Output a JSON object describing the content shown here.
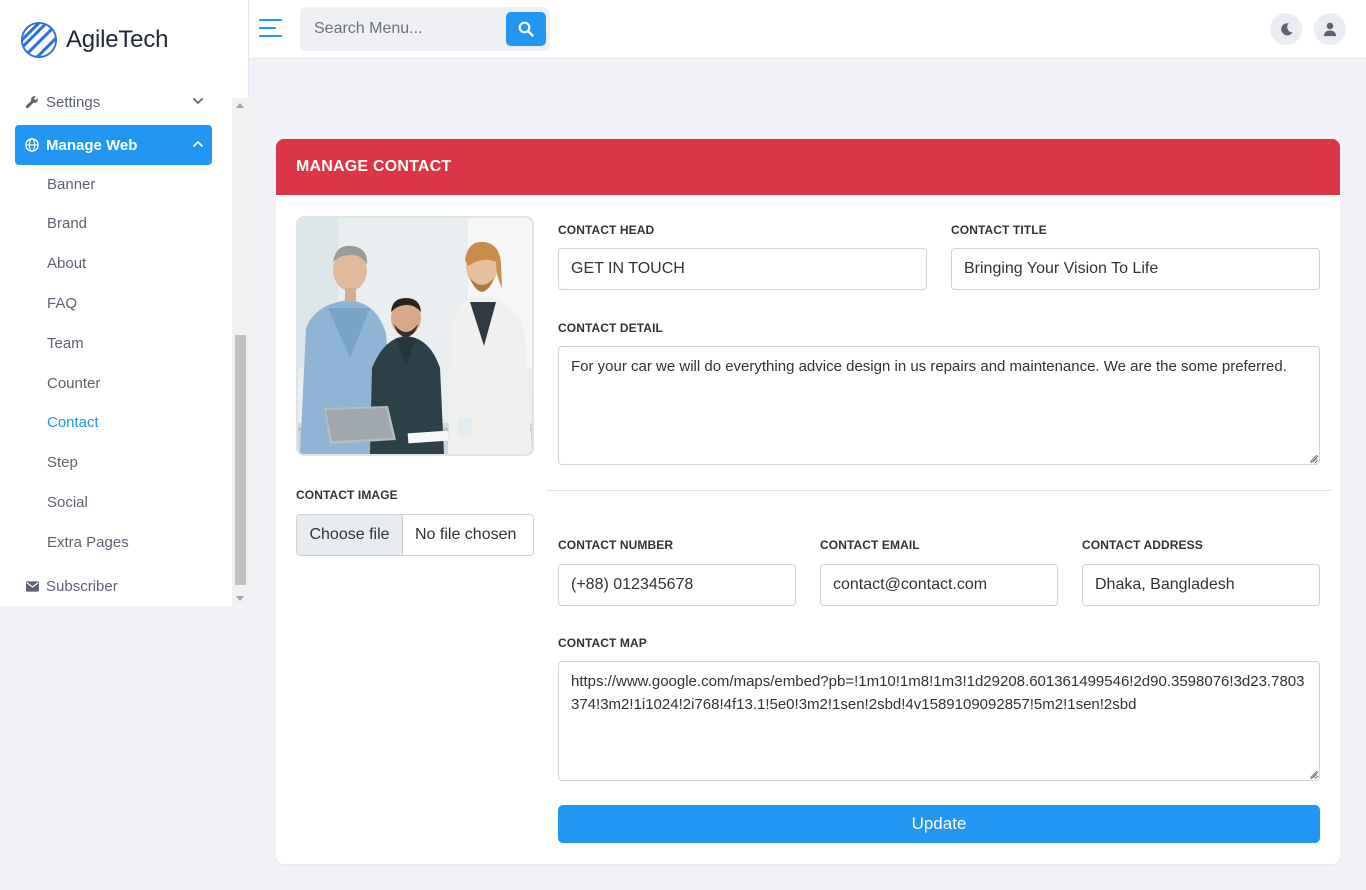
{
  "brand": {
    "name": "AgileTech"
  },
  "search": {
    "placeholder": "Search Menu..."
  },
  "sidebar": {
    "settings_label": "Settings",
    "manage_web_label": "Manage Web",
    "sub_items": [
      "Banner",
      "Brand",
      "About",
      "FAQ",
      "Team",
      "Counter",
      "Contact",
      "Step",
      "Social",
      "Extra Pages"
    ],
    "current_sub_item": "Contact",
    "subscriber_label": "Subscriber"
  },
  "card": {
    "title": "MANAGE CONTACT"
  },
  "form": {
    "contact_head": {
      "label": "CONTACT HEAD",
      "value": "GET IN TOUCH"
    },
    "contact_title": {
      "label": "CONTACT TITLE",
      "value": "Bringing Your Vision To Life"
    },
    "contact_detail": {
      "label": "CONTACT DETAIL",
      "value": "For your car we will do everything advice design in us repairs and maintenance. We are the some preferred."
    },
    "contact_image": {
      "label": "CONTACT IMAGE",
      "button": "Choose file",
      "status": "No file chosen"
    },
    "contact_number": {
      "label": "CONTACT NUMBER",
      "value": "(+88) 012345678"
    },
    "contact_email": {
      "label": "CONTACT EMAIL",
      "value": "contact@contact.com"
    },
    "contact_address": {
      "label": "CONTACT ADDRESS",
      "value": "Dhaka, Bangladesh"
    },
    "contact_map": {
      "label": "CONTACT MAP",
      "value": "https://www.google.com/maps/embed?pb=!1m10!1m8!1m3!1d29208.601361499546!2d90.3598076!3d23.7803374!3m2!1i1024!2i768!4f13.1!5e0!3m2!1sen!2sbd!4v1589109092857!5m2!1sen!2sbd"
    },
    "update_label": "Update"
  },
  "colors": {
    "accent": "#2196f3",
    "header": "#dc3545",
    "background": "#f0f2f7"
  },
  "icons": [
    "hamburger-icon",
    "search-icon",
    "moon-icon",
    "user-icon",
    "wrench-icon",
    "globe-icon",
    "envelope-icon",
    "chevron-down-icon",
    "chevron-up-icon"
  ]
}
